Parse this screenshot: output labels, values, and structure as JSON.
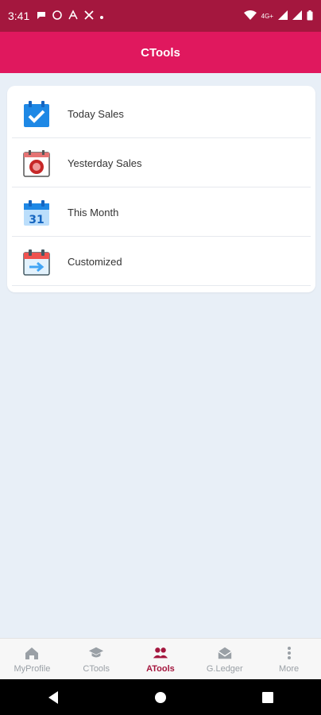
{
  "status_bar": {
    "time": "3:41",
    "network_label": "4G+"
  },
  "app_bar": {
    "title": "CTools"
  },
  "menu": {
    "items": [
      {
        "label": "Today Sales",
        "icon": "calendar-check-icon"
      },
      {
        "label": "Yesterday Sales",
        "icon": "calendar-clock-icon"
      },
      {
        "label": "This Month",
        "icon": "calendar-31-icon"
      },
      {
        "label": "Customized",
        "icon": "calendar-arrow-icon"
      }
    ]
  },
  "bottom_nav": {
    "items": [
      {
        "label": "MyProfile",
        "icon": "home-icon"
      },
      {
        "label": "CTools",
        "icon": "graduation-cap-icon"
      },
      {
        "label": "ATools",
        "icon": "people-icon",
        "active": true
      },
      {
        "label": "G.Ledger",
        "icon": "envelope-open-icon"
      },
      {
        "label": "More",
        "icon": "more-vertical-icon"
      }
    ]
  },
  "colors": {
    "status_bar": "#a4173e",
    "app_bar": "#e0185e",
    "active_nav": "#a4173e",
    "background": "#e8eff7"
  }
}
